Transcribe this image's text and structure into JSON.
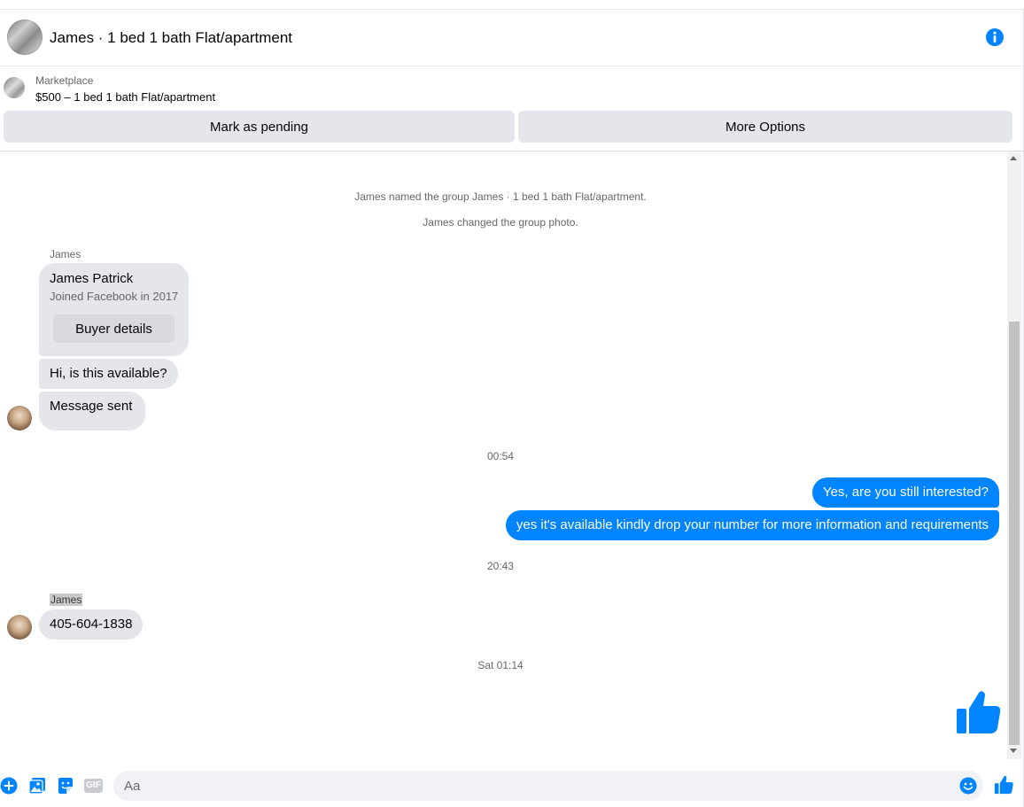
{
  "header": {
    "title": "James · 1 bed 1 bath Flat/apartment",
    "info_icon": "info-icon",
    "accent_color": "#0084ff"
  },
  "marketplace": {
    "label": "Marketplace",
    "listing": "$500 – 1 bed 1 bath Flat/apartment",
    "mark_pending_label": "Mark as pending",
    "more_options_label": "More Options"
  },
  "messages": {
    "system_1": "James named the group James · 1 bed 1 bath Flat/apartment.",
    "system_2": "James changed the group photo.",
    "sender_1": "James",
    "card_name": "James Patrick",
    "card_joined": "Joined Facebook in 2017",
    "card_button": "Buyer details",
    "in_1": "Hi, is this available?",
    "in_2": "Message sent",
    "stamp_1": "00:54",
    "out_1": "Yes, are you still interested?",
    "out_2": "yes it's available kindly drop your number for more information and requirements",
    "stamp_2": "20:43",
    "sender_2": "James",
    "in_3": "405-604-1838",
    "stamp_3": "Sat 01:14"
  },
  "composer": {
    "placeholder": "Aa",
    "icons": [
      "plus-icon",
      "photo-icon",
      "sticker-icon",
      "gif-icon",
      "emoji-icon",
      "like-icon"
    ],
    "gif_label": "GIF"
  }
}
